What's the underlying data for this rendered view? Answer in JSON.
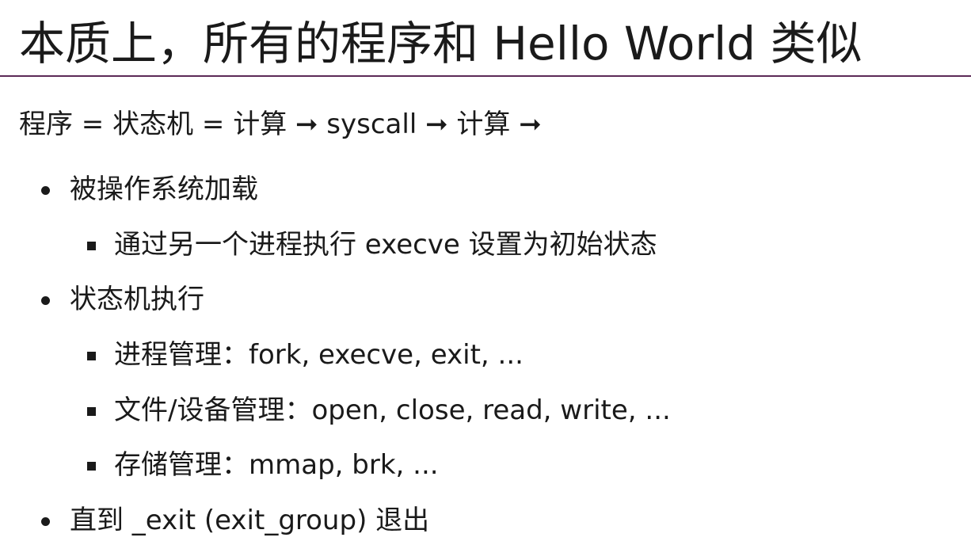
{
  "slide": {
    "title": "本质上，所有的程序和 Hello World 类似",
    "summary": "程序 = 状态机 = 计算 ➞ syscall ➞ 计算 ➞",
    "bullets": [
      {
        "level": 1,
        "text": "被操作系统加载"
      },
      {
        "level": 2,
        "text": "通过另一个进程执行 execve 设置为初始状态"
      },
      {
        "level": 1,
        "text": "状态机执行"
      },
      {
        "level": 2,
        "text": "进程管理：fork, execve, exit, ..."
      },
      {
        "level": 2,
        "text": "文件/设备管理：open, close, read, write, ..."
      },
      {
        "level": 2,
        "text": "存储管理：mmap, brk, ..."
      },
      {
        "level": 1,
        "text": "直到 _exit (exit_group) 退出"
      }
    ]
  },
  "colors": {
    "header_rule": "#5c2a57",
    "text": "#1a1a1a",
    "background": "#ffffff"
  }
}
